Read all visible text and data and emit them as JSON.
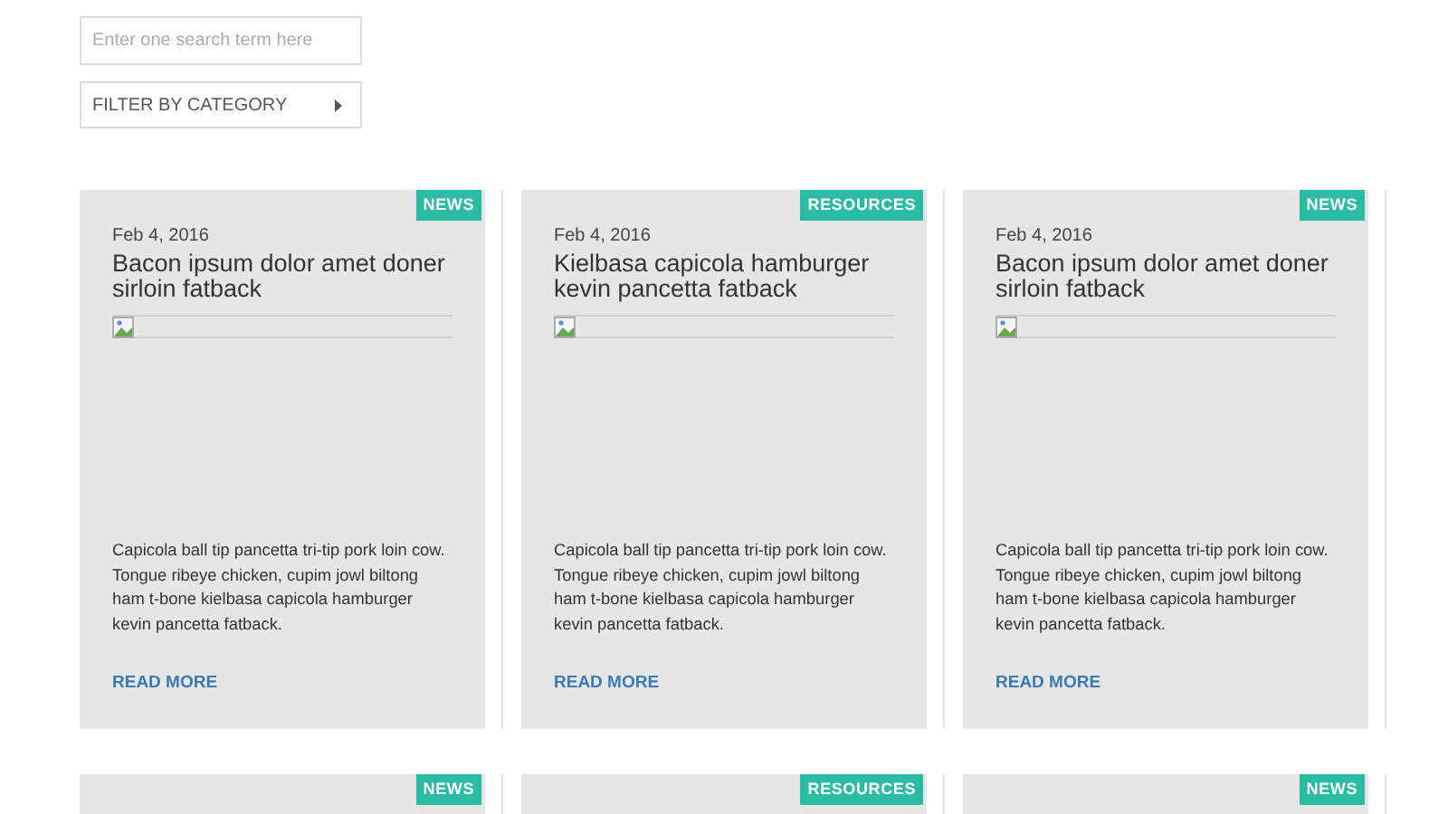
{
  "search": {
    "placeholder": "Enter one search term here"
  },
  "filter": {
    "label": "FILTER BY CATEGORY"
  },
  "cards": [
    {
      "badge": "NEWS",
      "date": "Feb 4, 2016",
      "title": "Bacon ipsum dolor amet doner sirloin fatback",
      "excerpt": "Capicola ball tip pancetta tri-tip pork loin cow. Tongue ribeye chicken, cupim jowl biltong ham t-bone kielbasa capicola hamburger kevin pancetta fatback.",
      "link": "READ MORE"
    },
    {
      "badge": "RESOURCES",
      "date": "Feb 4, 2016",
      "title": "Kielbasa capicola hamburger kevin pancetta fatback",
      "excerpt": "Capicola ball tip pancetta tri-tip pork loin cow. Tongue ribeye chicken, cupim jowl biltong ham t-bone kielbasa capicola hamburger kevin pancetta fatback.",
      "link": "READ MORE"
    },
    {
      "badge": "NEWS",
      "date": "Feb 4, 2016",
      "title": "Bacon ipsum dolor amet doner sirloin fatback",
      "excerpt": "Capicola ball tip pancetta tri-tip pork loin cow. Tongue ribeye chicken, cupim jowl biltong ham t-bone kielbasa capicola hamburger kevin pancetta fatback.",
      "link": "READ MORE"
    }
  ],
  "next_cards": [
    {
      "badge": "NEWS"
    },
    {
      "badge": "RESOURCES"
    },
    {
      "badge": "NEWS"
    }
  ]
}
